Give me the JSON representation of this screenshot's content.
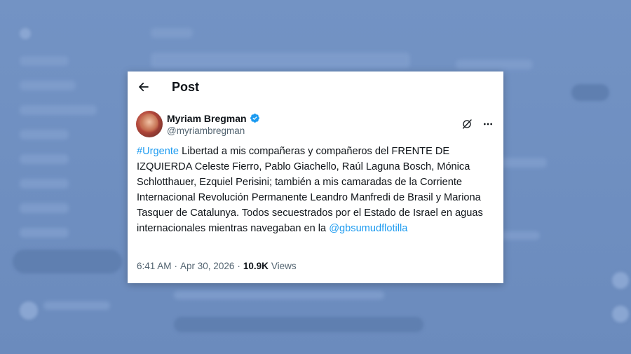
{
  "header": {
    "title": "Post"
  },
  "author": {
    "display_name": "Myriam Bregman",
    "handle": "@myriambregman"
  },
  "tweet": {
    "hashtag": "#Urgente",
    "body": " Libertad a mis compañeras y compañeros del FRENTE DE IZQUIERDA Celeste Fierro, Pablo Giachello, Raúl Laguna Bosch, Mónica Schlotthauer, Ezquiel Perisini; también a mis camaradas de la Corriente Internacional Revolución Permanente Leandro Manfredi de Brasil y Mariona Tasquer de Catalunya. Todos secuestrados por el Estado de Israel en aguas internacionales mientras navegaban en la ",
    "mention": "@gbsumudflotilla"
  },
  "meta": {
    "time": "6:41 AM",
    "separator": "·",
    "date": "Apr 30, 2026",
    "views_count": "10.9K",
    "views_label": "Views"
  },
  "colors": {
    "accent": "#1d9bf0",
    "text": "#0f1419",
    "muted": "#536471",
    "backdrop": "#6f8fbf"
  },
  "icons": {
    "back": "arrow-left-icon",
    "verified": "verified-badge-icon",
    "grok": "grok-icon",
    "more": "more-horizontal-icon"
  }
}
